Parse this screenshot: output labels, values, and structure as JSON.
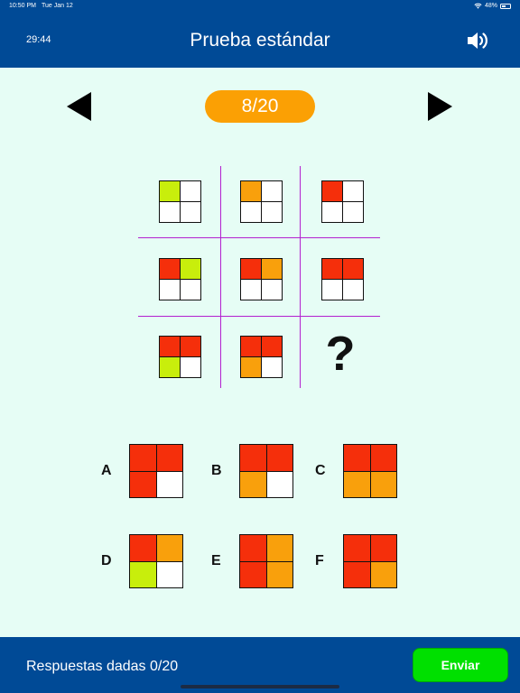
{
  "status_bar": {
    "time": "10:50 PM",
    "date": "Tue Jan 12",
    "battery": "48%",
    "battery_level": 0.48
  },
  "header": {
    "timer": "29:44",
    "title": "Prueba estándar",
    "sound_icon": "speaker-icon"
  },
  "navigation": {
    "counter": "8/20",
    "prev_icon": "triangle-left-icon",
    "next_icon": "triangle-right-icon"
  },
  "colors": {
    "red": "#f52f0b",
    "orange": "#f9a00c",
    "lime": "#c8ee0c",
    "white": "#ffffff",
    "header_blue": "#004a96",
    "grid_purple": "#b321cf",
    "submit_green": "#00e000"
  },
  "puzzle": {
    "cells": [
      [
        "lime",
        "white",
        "white",
        "white"
      ],
      [
        "orange",
        "white",
        "white",
        "white"
      ],
      [
        "red",
        "white",
        "white",
        "white"
      ],
      [
        "red",
        "lime",
        "white",
        "white"
      ],
      [
        "red",
        "orange",
        "white",
        "white"
      ],
      [
        "red",
        "red",
        "white",
        "white"
      ],
      [
        "red",
        "red",
        "lime",
        "white"
      ],
      [
        "red",
        "red",
        "orange",
        "white"
      ]
    ],
    "missing": "?"
  },
  "options": [
    {
      "letter": "A",
      "colors": [
        "red",
        "red",
        "red",
        "white"
      ]
    },
    {
      "letter": "B",
      "colors": [
        "red",
        "red",
        "orange",
        "white"
      ]
    },
    {
      "letter": "C",
      "colors": [
        "red",
        "red",
        "orange",
        "orange"
      ]
    },
    {
      "letter": "D",
      "colors": [
        "red",
        "orange",
        "lime",
        "white"
      ]
    },
    {
      "letter": "E",
      "colors": [
        "red",
        "orange",
        "red",
        "orange"
      ]
    },
    {
      "letter": "F",
      "colors": [
        "red",
        "red",
        "red",
        "orange"
      ]
    }
  ],
  "footer": {
    "answered": "Respuestas dadas 0/20",
    "submit_label": "Enviar"
  }
}
